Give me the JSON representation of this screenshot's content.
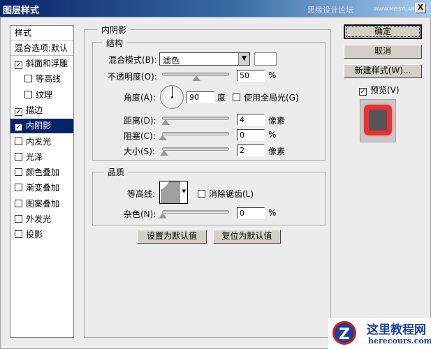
{
  "window": {
    "title": "图层样式",
    "watermark": "思缘设计论坛",
    "watermark_url": "WWW.MISSYUAN.COM",
    "close": "X"
  },
  "sidebar": {
    "header": "样式",
    "blend": "混合选项:默认",
    "items": [
      {
        "label": "斜面和浮雕",
        "checked": true,
        "indent": false
      },
      {
        "label": "等高线",
        "checked": false,
        "indent": true
      },
      {
        "label": "纹理",
        "checked": false,
        "indent": true
      },
      {
        "label": "描边",
        "checked": true,
        "indent": false
      },
      {
        "label": "内阴影",
        "checked": true,
        "indent": false,
        "selected": true
      },
      {
        "label": "内发光",
        "checked": false,
        "indent": false
      },
      {
        "label": "光泽",
        "checked": false,
        "indent": false
      },
      {
        "label": "颜色叠加",
        "checked": false,
        "indent": false
      },
      {
        "label": "渐变叠加",
        "checked": false,
        "indent": false
      },
      {
        "label": "图案叠加",
        "checked": false,
        "indent": false
      },
      {
        "label": "外发光",
        "checked": false,
        "indent": false
      },
      {
        "label": "投影",
        "checked": false,
        "indent": false
      }
    ]
  },
  "panel": {
    "title": "内阴影",
    "structure": {
      "title": "结构",
      "blend_label": "混合模式(B):",
      "blend_value": "滤色",
      "opacity_label": "不透明度(O):",
      "opacity": "50",
      "opacity_unit": "%",
      "opacity_frac": 0.5,
      "angle_label": "角度(A):",
      "angle": "90",
      "angle_unit": "度",
      "global_light": "使用全局光(G)",
      "global_light_checked": false,
      "distance_label": "距离(D):",
      "distance": "4",
      "distance_unit": "像素",
      "choke_label": "阻塞(C):",
      "choke": "0",
      "choke_unit": "%",
      "size_label": "大小(S):",
      "size": "2",
      "size_unit": "像素"
    },
    "quality": {
      "title": "品质",
      "contour_label": "等高线:",
      "antialias": "消除锯齿(L)",
      "antialias_checked": false,
      "noise_label": "杂色(N):",
      "noise": "0",
      "noise_unit": "%"
    },
    "make_default": "设置为默认值",
    "reset_default": "复位为默认值"
  },
  "buttons": {
    "ok": "确定",
    "cancel": "取消",
    "new_style": "新建样式(W)...",
    "preview": "预览(V)",
    "preview_checked": true
  },
  "logo": {
    "name": "这里教程网",
    "url": "herecours.com"
  }
}
